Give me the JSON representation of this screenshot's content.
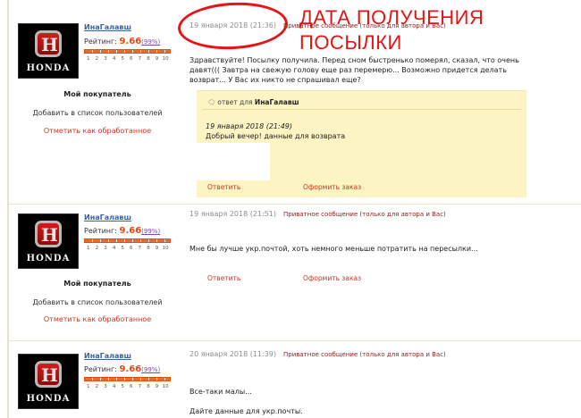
{
  "annotation": {
    "line1": "ДАТА ПОЛУЧЕНИЯ",
    "line2": "ПОСЫЛКИ"
  },
  "posts": [
    {
      "username": "ИнаГалавш",
      "avatar_brand": "HONDA",
      "rating_label": "Рейтинг:",
      "rating_value": "9.66",
      "rating_pct": "(99%)",
      "buyer_label": "Мой покупатель",
      "add_user": "Добавить в список пользователей",
      "mark_done": "Отметить как обработанное",
      "date": "19 января 2018 (21:36)",
      "private": "Приватное сообщение (только для автора и Вас)",
      "lines": [
        "Здравствуйте! Посылку получила. Перед сном быстренько померял, сказал, что очень",
        "давят((( Завтра на свежую голову еще раз перемерю... Возможно придется делать",
        "возврат... У Вас их никто не спрашивал еще?"
      ],
      "reply": {
        "label": "ответ для",
        "name": "ИнаГалавш",
        "date": "19 января 2018 (21:49)",
        "text": "Добрый вечер! данные для возврата"
      },
      "reply_link": "Ответить",
      "order_link": "Оформить заказ"
    },
    {
      "username": "ИнаГалавш",
      "avatar_brand": "HONDA",
      "rating_label": "Рейтинг:",
      "rating_value": "9.66",
      "rating_pct": "(99%)",
      "buyer_label": "Мой покупатель",
      "add_user": "Добавить в список пользователей",
      "mark_done": "Отметить как обработанное",
      "date": "19 января 2018 (21:51)",
      "private": "Приватное сообщение (только для автора и Вас)",
      "lines": [
        "Мне бы лучше укр.почтой, хоть немного меньше потратить на пересылки..."
      ],
      "reply_link": "Ответить",
      "order_link": "Оформить заказ"
    },
    {
      "username": "ИнаГалавш",
      "avatar_brand": "HONDA",
      "rating_label": "Рейтинг:",
      "rating_value": "9.66",
      "rating_pct": "(99%)",
      "date": "20 января 2018 (11:39)",
      "private": "Приватное сообщение (только для автора и Вас)",
      "lines": [
        "Все-таки малы...",
        "Дайте данные для укр.почты."
      ]
    }
  ],
  "rating_scale": [
    "1",
    "2",
    "3",
    "4",
    "5",
    "6",
    "7",
    "8",
    "9",
    "10"
  ],
  "colors": {
    "accent_red": "#d0351f",
    "rating_orange": "#ee6a26",
    "reply_bg": "#fdf4c3",
    "annotation": "#e11616"
  },
  "icons": {
    "reply_bubble": "speech-bubble-icon"
  }
}
